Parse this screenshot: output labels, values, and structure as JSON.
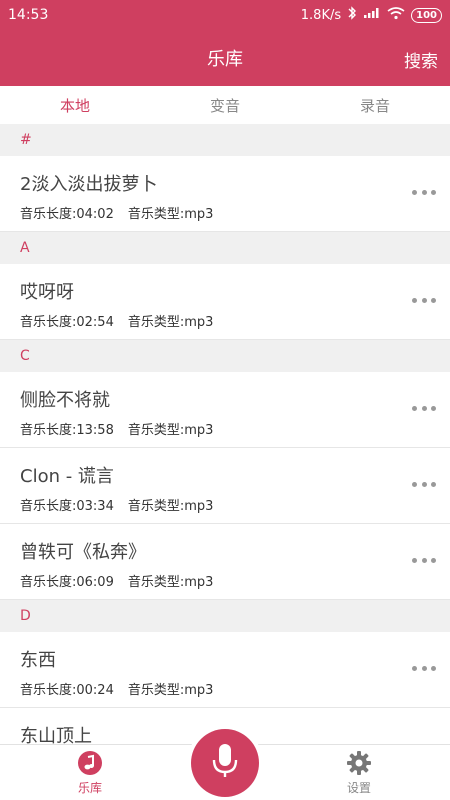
{
  "status_bar": {
    "time": "14:53",
    "network_speed": "1.8K/s",
    "battery": "100"
  },
  "header": {
    "title": "乐库",
    "search_label": "搜索"
  },
  "tabs": [
    {
      "label": "本地",
      "active": true
    },
    {
      "label": "变音",
      "active": false
    },
    {
      "label": "录音",
      "active": false
    }
  ],
  "sections": [
    {
      "letter": "#",
      "songs": [
        {
          "title": "2淡入淡出拔萝卜",
          "duration": "音乐长度:04:02",
          "type": "音乐类型:mp3"
        }
      ]
    },
    {
      "letter": "A",
      "songs": [
        {
          "title": "哎呀呀",
          "duration": "音乐长度:02:54",
          "type": "音乐类型:mp3"
        }
      ]
    },
    {
      "letter": "C",
      "songs": [
        {
          "title": "侧脸不将就",
          "duration": "音乐长度:13:58",
          "type": "音乐类型:mp3"
        },
        {
          "title": "Clon - 谎言",
          "duration": "音乐长度:03:34",
          "type": "音乐类型:mp3"
        },
        {
          "title": "曾轶可《私奔》",
          "duration": "音乐长度:06:09",
          "type": "音乐类型:mp3"
        }
      ]
    },
    {
      "letter": "D",
      "songs": [
        {
          "title": "东西",
          "duration": "音乐长度:00:24",
          "type": "音乐类型:mp3"
        },
        {
          "title": "东山顶上",
          "duration": "",
          "type": ""
        }
      ]
    }
  ],
  "bottom_nav": {
    "library_label": "乐库",
    "settings_label": "设置"
  },
  "colors": {
    "accent": "#cf3f60",
    "section_bg": "#f0f0f0"
  },
  "icons": {
    "library": "music-note-icon",
    "record": "microphone-icon",
    "settings": "gear-icon",
    "more": "more-dots-icon"
  }
}
